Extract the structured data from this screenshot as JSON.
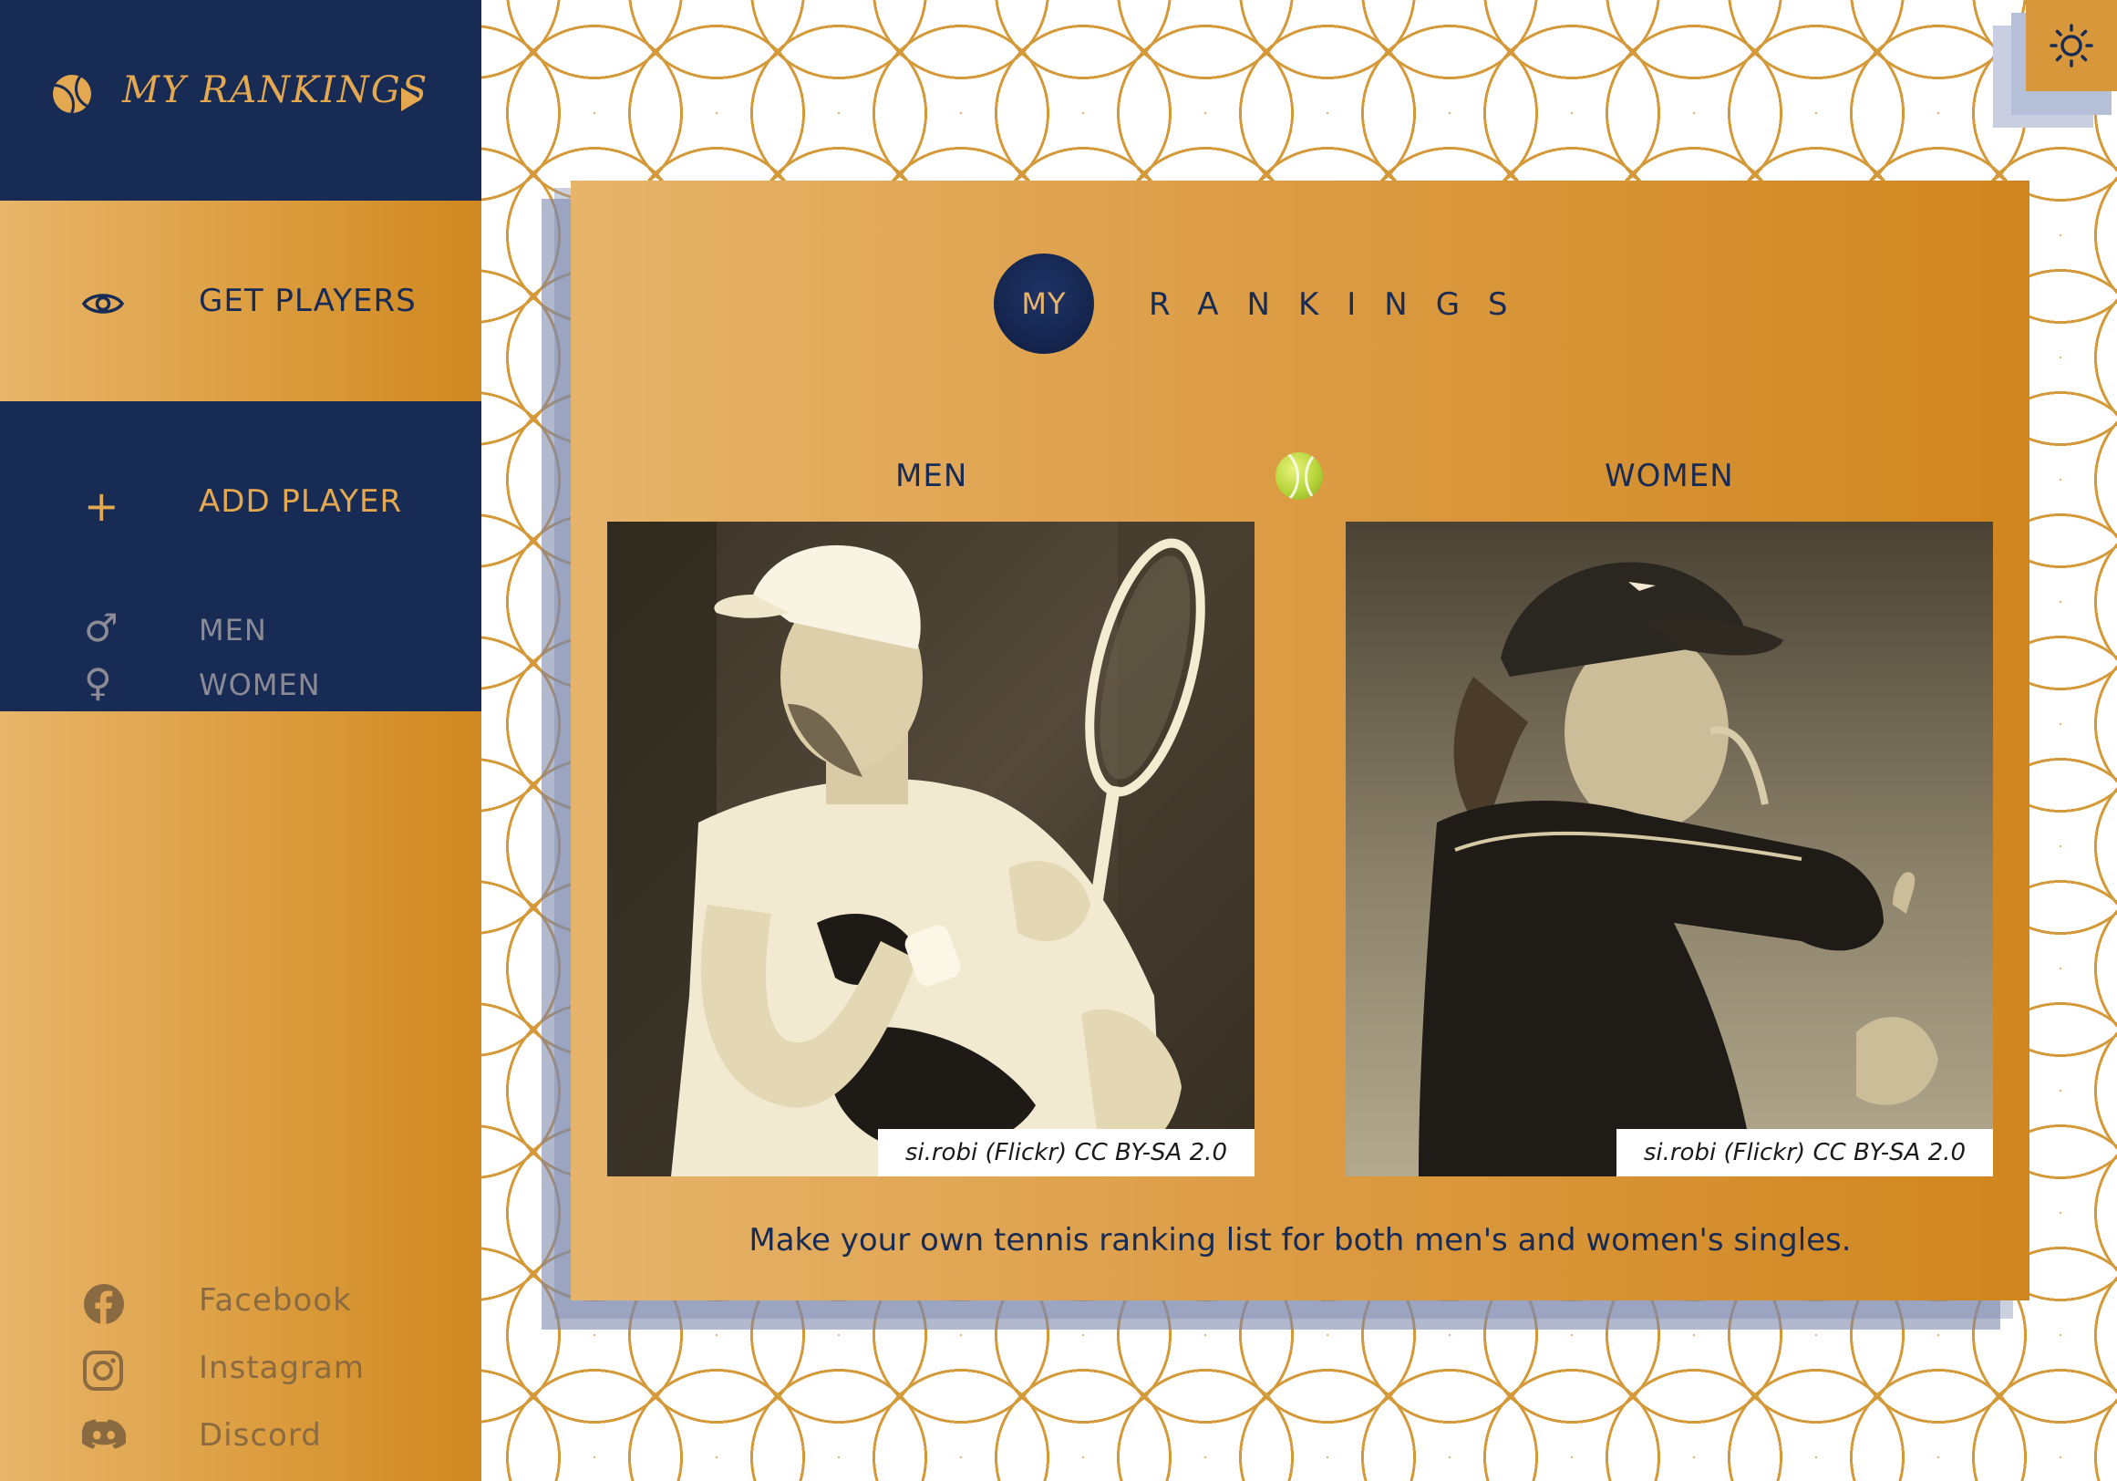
{
  "sidebar": {
    "brand": {
      "title": "MY RANKINGS",
      "icon": "tennis-ball-icon"
    },
    "nav": {
      "get_players": {
        "label": "GET PLAYERS",
        "icon": "eye-icon"
      },
      "add_player": {
        "label": "ADD PLAYER",
        "icon": "plus-icon"
      },
      "sub_items": [
        {
          "label": "MEN",
          "icon": "male-icon",
          "glyph": "♂"
        },
        {
          "label": "WOMEN",
          "icon": "female-icon",
          "glyph": "♀"
        }
      ]
    },
    "social": [
      {
        "label": "Facebook",
        "icon": "facebook-icon"
      },
      {
        "label": "Instagram",
        "icon": "instagram-icon"
      },
      {
        "label": "Discord",
        "icon": "discord-icon"
      }
    ]
  },
  "theme_toggle": {
    "icon": "sun-icon"
  },
  "main": {
    "logo_circle": "MY",
    "logo_word": "RANKINGS",
    "men": {
      "title": "MEN",
      "credit": "si.robi (Flickr)   CC BY-SA 2.0"
    },
    "women": {
      "title": "WOMEN",
      "credit": "si.robi (Flickr)   CC BY-SA 2.0"
    },
    "tagline": "Make your own tennis ranking list for both men's and women's singles."
  },
  "colors": {
    "navy": "#182b54",
    "gold": "#e3a850",
    "orange": "#d0881f"
  }
}
